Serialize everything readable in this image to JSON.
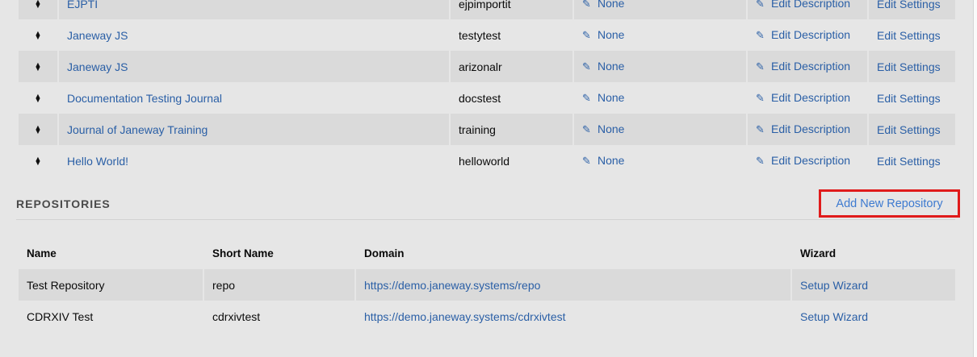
{
  "journals": {
    "rows": [
      {
        "name": "EJPTI",
        "code": "ejpimportit",
        "none": "None",
        "desc": "Edit Description",
        "settings": "Edit Settings"
      },
      {
        "name": "Janeway JS",
        "code": "testytest",
        "none": "None",
        "desc": "Edit Description",
        "settings": "Edit Settings"
      },
      {
        "name": "Janeway JS",
        "code": "arizonalr",
        "none": "None",
        "desc": "Edit Description",
        "settings": "Edit Settings"
      },
      {
        "name": "Documentation Testing Journal",
        "code": "docstest",
        "none": "None",
        "desc": "Edit Description",
        "settings": "Edit Settings"
      },
      {
        "name": "Journal of Janeway Training",
        "code": "training",
        "none": "None",
        "desc": "Edit Description",
        "settings": "Edit Settings"
      },
      {
        "name": "Hello World!",
        "code": "helloworld",
        "none": "None",
        "desc": "Edit Description",
        "settings": "Edit Settings"
      }
    ]
  },
  "repositories": {
    "heading": "REPOSITORIES",
    "add_label": "Add New Repository",
    "columns": [
      "Name",
      "Short Name",
      "Domain",
      "Wizard"
    ],
    "rows": [
      {
        "name": "Test Repository",
        "short": "repo",
        "domain": "https://demo.janeway.systems/repo",
        "wizard": "Setup Wizard"
      },
      {
        "name": "CDRXIV Test",
        "short": "cdrxivtest",
        "domain": "https://demo.janeway.systems/cdrxivtest",
        "wizard": "Setup Wizard"
      }
    ]
  },
  "colors": {
    "link": "#2a5fa6",
    "highlight_border": "#e01b1b"
  }
}
